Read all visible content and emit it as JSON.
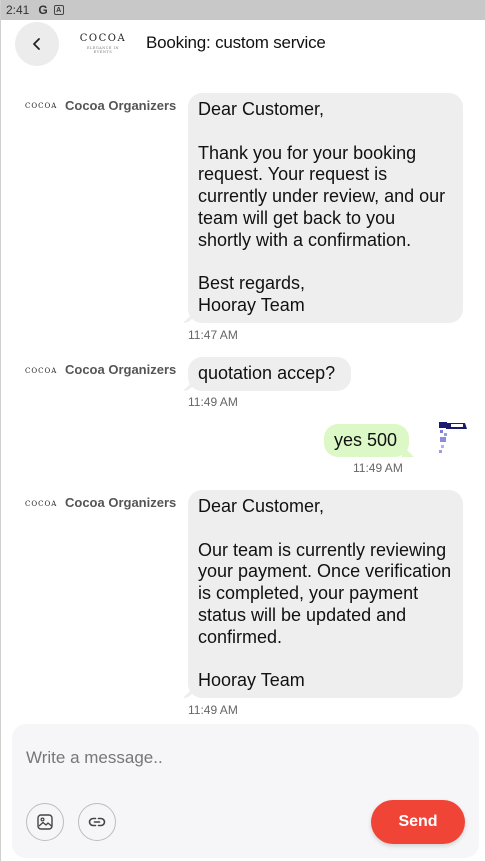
{
  "status_bar": {
    "time": "2:41",
    "icons": [
      "google-icon",
      "accessibility-icon"
    ]
  },
  "header": {
    "logo_text": "COCOA",
    "logo_subtext": "ELEGANCE IN EVENTS",
    "title": "Booking: custom service"
  },
  "messages": [
    {
      "direction": "incoming",
      "sender": "Cocoa Organizers",
      "avatar_text": "COCOA",
      "text": "Dear Customer,\n\nThank you for your booking request. Your request is currently under review, and our team will get back to you shortly with a confirmation.\n\nBest regards,\nHooray Team",
      "time": "11:47 AM"
    },
    {
      "direction": "incoming",
      "sender": "Cocoa Organizers",
      "avatar_text": "COCOA",
      "text": "quotation accep?",
      "time": "11:49 AM"
    },
    {
      "direction": "outgoing",
      "text": "yes 500",
      "time": "11:49 AM"
    },
    {
      "direction": "incoming",
      "sender": "Cocoa Organizers",
      "avatar_text": "COCOA",
      "text": "Dear Customer,\n\nOur team is currently reviewing your payment. Once verification is completed, your payment status will be updated and confirmed.\n\nHooray Team",
      "time": "11:49 AM"
    }
  ],
  "composer": {
    "placeholder": "Write a message..",
    "send_label": "Send",
    "icons": [
      "image-icon",
      "link-icon"
    ]
  },
  "colors": {
    "accent": "#f04437",
    "incoming_bubble": "#eeeeee",
    "outgoing_bubble": "#dcf8c6"
  }
}
